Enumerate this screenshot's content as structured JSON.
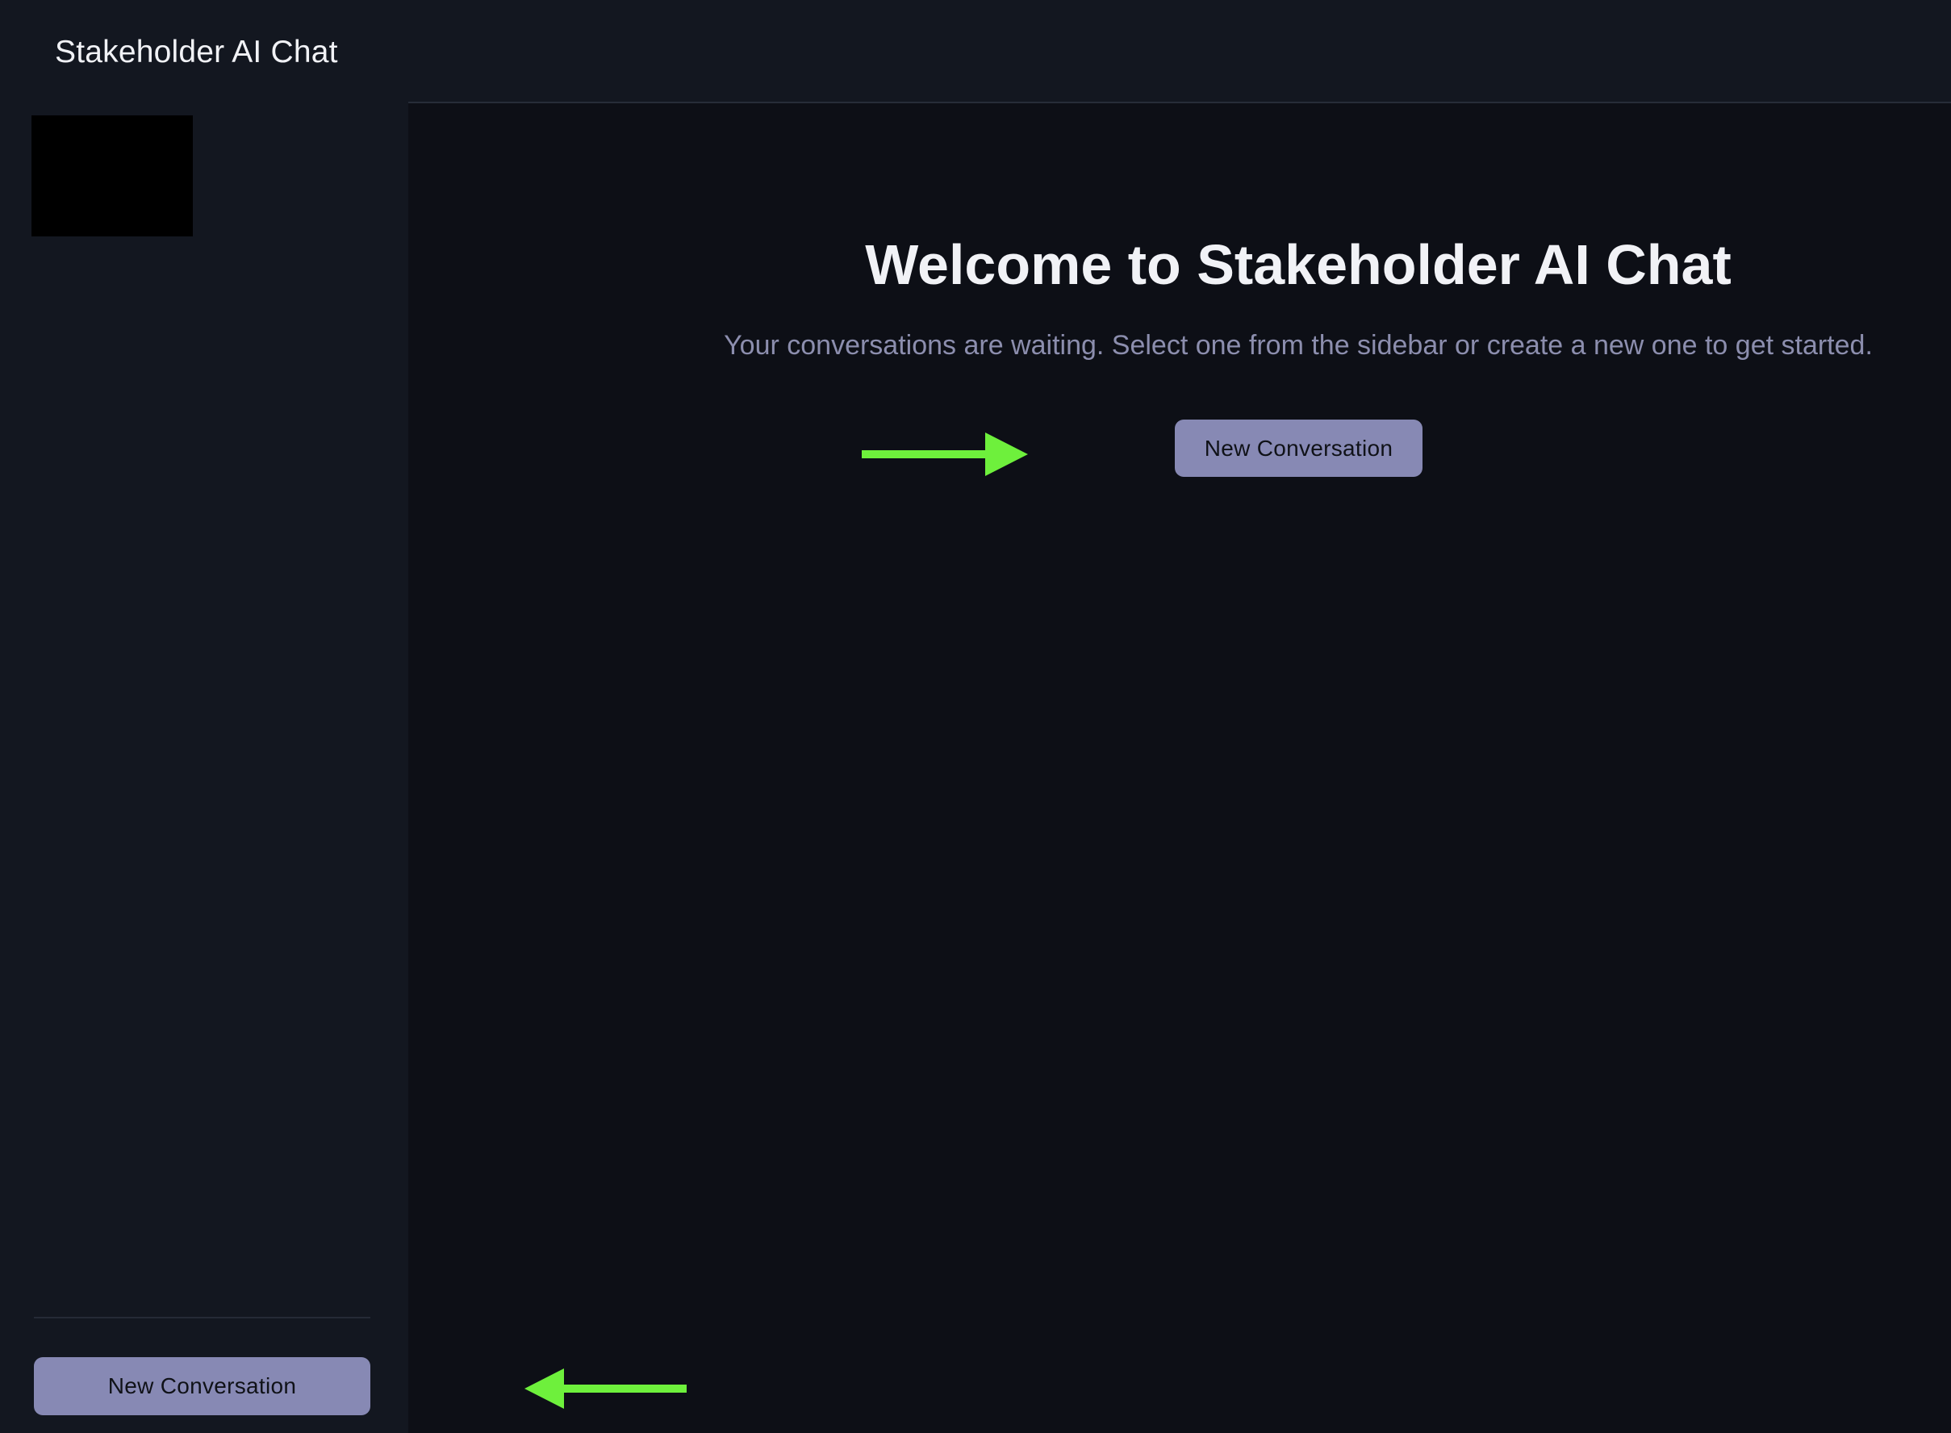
{
  "sidebar": {
    "title": "Stakeholder AI Chat",
    "new_conversation_label": "New Conversation"
  },
  "main": {
    "welcome_title": "Welcome to Stakeholder AI Chat",
    "welcome_subtitle": "Your conversations are waiting. Select one from the sidebar or create a new one to get started.",
    "new_conversation_label": "New Conversation"
  },
  "annotations": {
    "arrow_color": "#6ef03c"
  },
  "colors": {
    "button_bg": "#8789b4",
    "sidebar_bg": "#131720",
    "main_bg": "#0d0f16"
  }
}
